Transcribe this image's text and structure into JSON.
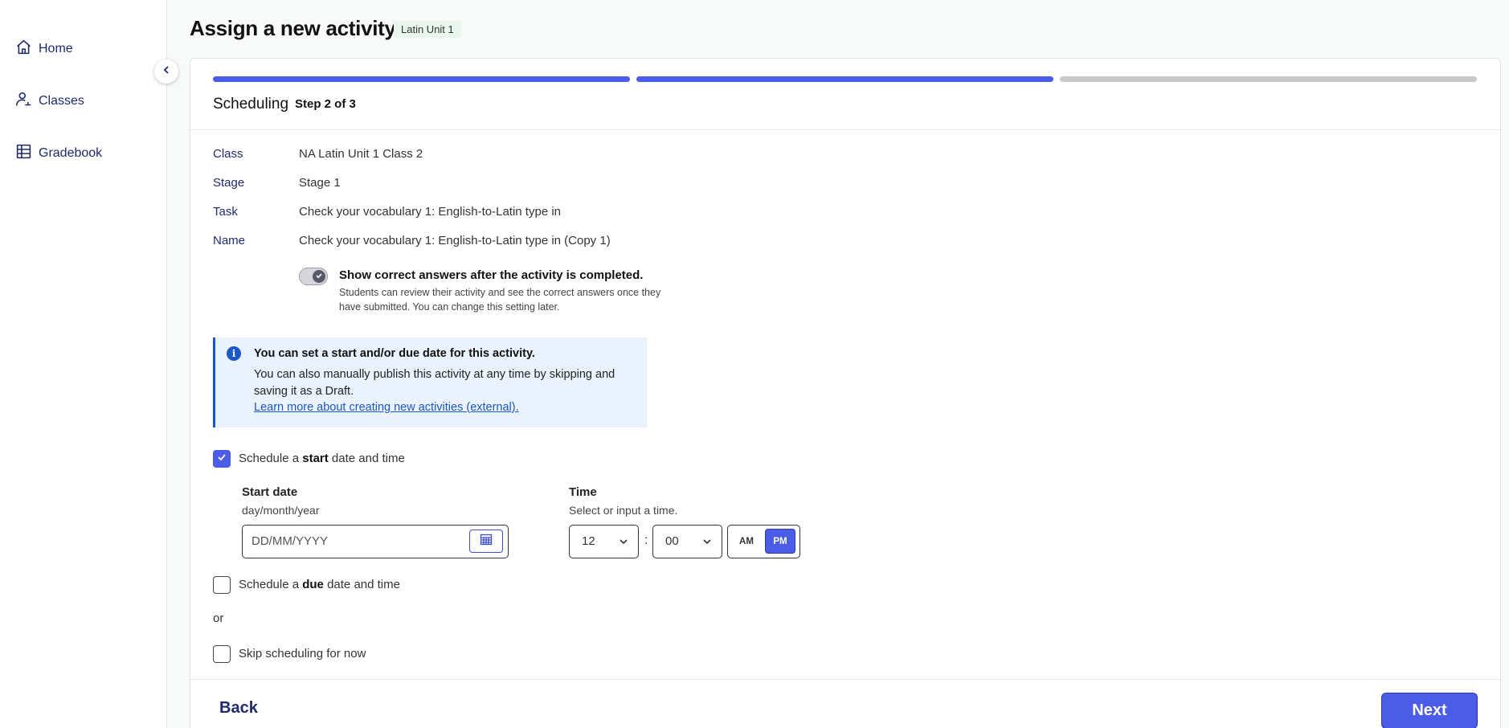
{
  "sidebar": {
    "items": [
      {
        "label": "Home",
        "icon": "home-icon"
      },
      {
        "label": "Classes",
        "icon": "classes-icon"
      },
      {
        "label": "Gradebook",
        "icon": "gradebook-icon"
      }
    ],
    "collapse_icon": "chevron-left-icon"
  },
  "header": {
    "title": "Assign a new activity",
    "badge": "Latin Unit 1"
  },
  "wizard": {
    "step_title": "Scheduling",
    "step_count": "Step 2 of 3",
    "steps_total": 3,
    "steps_completed": 2,
    "accent_color": "#4b5ce6"
  },
  "details": {
    "class": {
      "label": "Class",
      "value": "NA Latin Unit 1 Class 2"
    },
    "stage": {
      "label": "Stage",
      "value": "Stage 1"
    },
    "task": {
      "label": "Task",
      "value": "Check your vocabulary 1: English-to-Latin type in"
    },
    "name": {
      "label": "Name",
      "value": "Check your vocabulary 1: English-to-Latin type in (Copy 1)"
    }
  },
  "toggle": {
    "title": "Show correct answers after the activity is completed.",
    "help": "Students can review their activity and see the correct answers once they have submitted. You can change this setting later.",
    "on": true
  },
  "info": {
    "title": "You can set a start and/or due date for this activity.",
    "body": "You can also manually publish this activity at any time by skipping and saving it as a Draft.",
    "link": "Learn more about creating new activities (external)."
  },
  "start_schedule": {
    "prefix": "Schedule a",
    "emphasis": "start",
    "suffix": "date and time",
    "checked": true,
    "date_label": "Start date",
    "date_help": "day/month/year",
    "date_placeholder": "DD/MM/YYYY",
    "time_label": "Time",
    "time_help": "Select or input a time.",
    "hour": "12",
    "minute": "00",
    "separator": ":",
    "am": "AM",
    "pm": "PM",
    "selected_period": "PM"
  },
  "due_schedule": {
    "prefix": "Schedule a",
    "emphasis": "due",
    "suffix": "date and time",
    "checked": false
  },
  "or_text": "or",
  "skip": {
    "label": "Skip scheduling for now",
    "checked": false
  },
  "footer": {
    "back": "Back",
    "next": "Next"
  }
}
